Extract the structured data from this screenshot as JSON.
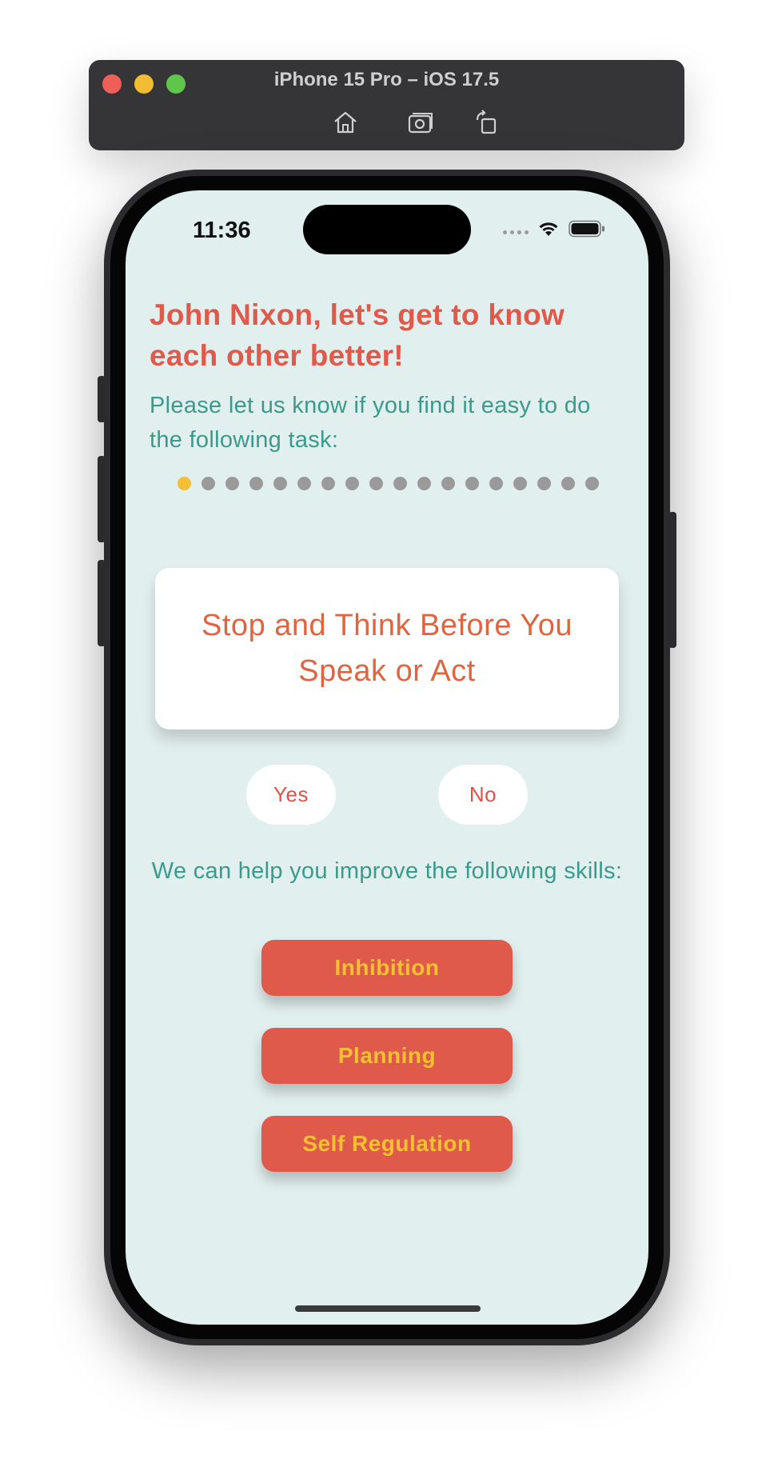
{
  "simulator": {
    "title": "iPhone 15 Pro – iOS 17.5",
    "tools": [
      "home-icon",
      "screenshot-icon",
      "rotate-icon"
    ]
  },
  "status_bar": {
    "time": "11:36",
    "icons": [
      "cellular-icon",
      "wifi-icon",
      "battery-icon"
    ]
  },
  "heading": "John Nixon, let's get to know each other better!",
  "subheading": "Please let us know if you find it easy to do the following task:",
  "progress": {
    "total": 18,
    "current": 1,
    "active_color": "#f4c033",
    "inactive_color": "#9a9a9a"
  },
  "task": "Stop and Think Before You Speak or Act",
  "answers": {
    "yes": "Yes",
    "no": "No"
  },
  "help_text": "We can help you improve the following skills:",
  "skills": [
    "Inhibition",
    "Planning",
    "Self Regulation"
  ],
  "colors": {
    "background": "#e1efee",
    "accent_red": "#e05a4b",
    "accent_yellow": "#f4c033",
    "teal_text": "#3a9a8c"
  }
}
